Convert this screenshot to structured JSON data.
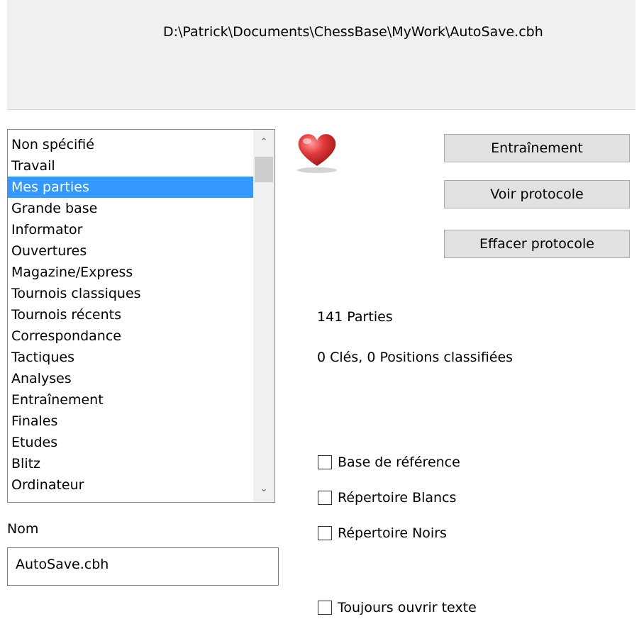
{
  "path": "D:\\Patrick\\Documents\\ChessBase\\MyWork\\AutoSave.cbh",
  "type_list": {
    "items": [
      "Non spécifié",
      "Travail",
      "Mes parties",
      "Grande base",
      "Informator",
      "Ouvertures",
      "Magazine/Express",
      "Tournois classiques",
      "Tournois récents",
      "Correspondance",
      "Tactiques",
      "Analyses",
      "Entraînement",
      "Finales",
      "Etudes",
      "Blitz",
      "Ordinateur"
    ],
    "selected": "Mes parties"
  },
  "favorite_icon": "heart-icon",
  "buttons": {
    "training": "Entraînement",
    "view_log": "Voir protocole",
    "clear_log": "Effacer protocole"
  },
  "stats": {
    "games": "141 Parties",
    "keys": "0 Clés, 0 Positions classifiées"
  },
  "checkboxes": {
    "reference": {
      "label": "Base de référence",
      "checked": false
    },
    "white_rep": {
      "label": "Répertoire Blancs",
      "checked": false
    },
    "black_rep": {
      "label": "Répertoire Noirs",
      "checked": false
    },
    "always_open_text": {
      "label": "Toujours ouvrir texte",
      "checked": false
    }
  },
  "name": {
    "label": "Nom",
    "value": "AutoSave.cbh"
  },
  "colors": {
    "selection": "#3399ff",
    "heart": "#d22a2a"
  }
}
